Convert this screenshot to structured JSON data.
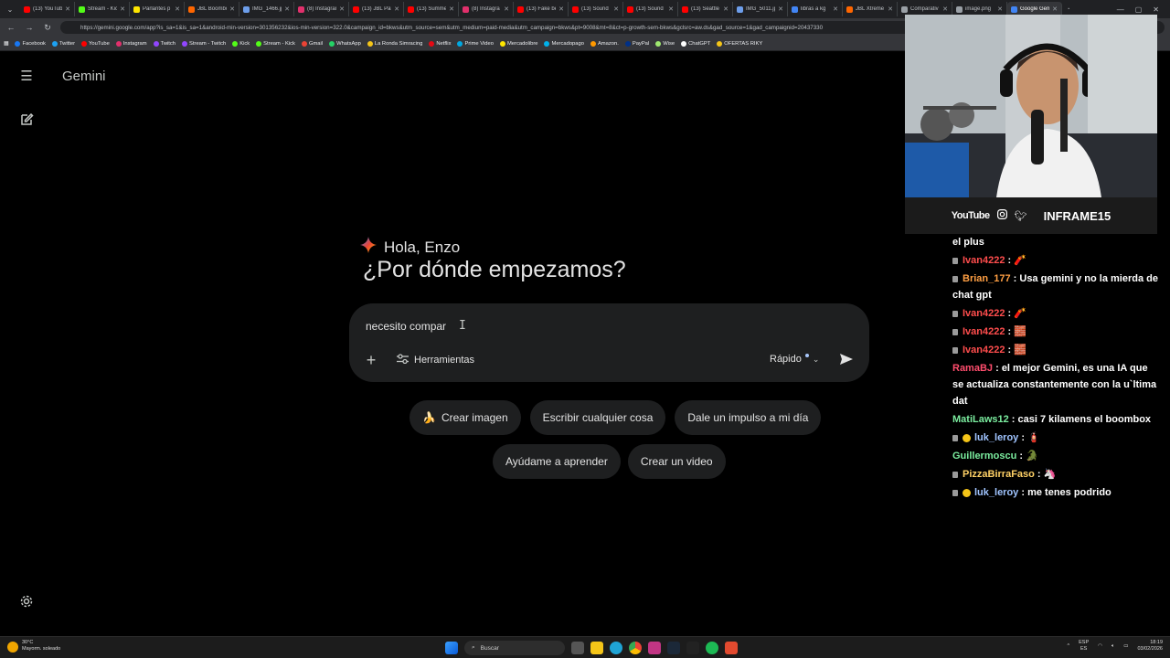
{
  "browser": {
    "tabs": [
      {
        "label": "(13) YouTube",
        "color": "#ff0000"
      },
      {
        "label": "Stream - Kick",
        "color": "#53fc18"
      },
      {
        "label": "Parlantes p",
        "color": "#ffe600"
      },
      {
        "label": "JBL Boombo",
        "color": "#ff6600"
      },
      {
        "label": "IMG_1466.jp",
        "color": "#6d9eeb"
      },
      {
        "label": "(8) Instagram",
        "color": "#e1306c"
      },
      {
        "label": "(13) JBL Par",
        "color": "#ff0000"
      },
      {
        "label": "(13) Summe",
        "color": "#ff0000"
      },
      {
        "label": "(8) Instagra",
        "color": "#e1306c"
      },
      {
        "label": "(13) Fake be",
        "color": "#ff0000"
      },
      {
        "label": "(13) Sound",
        "color": "#ff0000"
      },
      {
        "label": "(13) Sound",
        "color": "#ff0000"
      },
      {
        "label": "(13) Seattle",
        "color": "#ff0000"
      },
      {
        "label": "IMG_5011.jp",
        "color": "#6d9eeb"
      },
      {
        "label": "libras a kg",
        "color": "#4285f4"
      },
      {
        "label": "JBL Xtreme",
        "color": "#ff6600"
      },
      {
        "label": "Comparativ",
        "color": "#9aa0a6"
      },
      {
        "label": "image.png",
        "color": "#9aa0a6"
      },
      {
        "label": "Google Gem",
        "color": "#4285f4",
        "active": true
      }
    ],
    "tab_close": "✕",
    "new_tab": "+",
    "url": "https://gemini.google.com/app?is_sa=1&is_sa=1&android-min-version=301356232&ios-min-version=322.0&campaign_id=bkws&utm_source=sem&utm_medium=paid-media&utm_campaign=bkws&pt=9008&mt=8&ct=p-growth-sem-bkws&gclsrc=aw.ds&gad_source=1&gad_campaignid=20437330",
    "bookmarks": [
      {
        "label": "Facebook",
        "color": "#1877f2"
      },
      {
        "label": "Twitter",
        "color": "#1da1f2"
      },
      {
        "label": "YouTube",
        "color": "#ff0000"
      },
      {
        "label": "Instagram",
        "color": "#e1306c"
      },
      {
        "label": "Twitch",
        "color": "#9146ff"
      },
      {
        "label": "Stream - Twitch",
        "color": "#9146ff"
      },
      {
        "label": "Kick",
        "color": "#53fc18"
      },
      {
        "label": "Stream - Kick",
        "color": "#53fc18"
      },
      {
        "label": "Gmail",
        "color": "#ea4335"
      },
      {
        "label": "WhatsApp",
        "color": "#25d366"
      },
      {
        "label": "La Ronda Simracing",
        "color": "#f5c518"
      },
      {
        "label": "Netflix",
        "color": "#e50914"
      },
      {
        "label": "Prime Video",
        "color": "#00a8e1"
      },
      {
        "label": "Mercadolibre",
        "color": "#ffe600"
      },
      {
        "label": "Mercadopago",
        "color": "#00b1ea"
      },
      {
        "label": "Amazon.",
        "color": "#ff9900"
      },
      {
        "label": "PayPal",
        "color": "#003087"
      },
      {
        "label": "Wise",
        "color": "#9fe870"
      },
      {
        "label": "ChatGPT",
        "color": "#ffffff"
      },
      {
        "label": "OFERTAS RIKY",
        "color": "#f5c518"
      }
    ]
  },
  "gemini": {
    "app_name": "Gemini",
    "greeting": "Hola, Enzo",
    "headline": "¿Por dónde empezamos?",
    "prompt_text": "necesito compar",
    "tools_label": "Herramientas",
    "mode_label": "Rápido",
    "suggestions_row1": [
      {
        "label": "Crear imagen",
        "emoji": "🍌"
      },
      {
        "label": "Escribir cualquier cosa",
        "emoji": ""
      },
      {
        "label": "Dale un impulso a mi día",
        "emoji": ""
      }
    ],
    "suggestions_row2": [
      {
        "label": "Ayúdame a aprender",
        "emoji": ""
      },
      {
        "label": "Crear un video",
        "emoji": ""
      }
    ],
    "accent_colors": [
      "#4285f4",
      "#ea4335",
      "#fbbc04",
      "#34a853"
    ]
  },
  "stream": {
    "youtube_label": "YouTube",
    "channel_handle": "INFRAME15",
    "chat": [
      {
        "user": "",
        "text": "el plus",
        "color": "#ffffff"
      },
      {
        "user": "Ivan4222",
        "text": "🧨",
        "color": "#ff4d4d",
        "badge": "icon"
      },
      {
        "user": "Brian_177",
        "text": "Usa gemini y no la mierda de chat gpt",
        "color": "#ff9f43",
        "badge": "icon"
      },
      {
        "user": "Ivan4222",
        "text": "🧨",
        "color": "#ff4d4d",
        "badge": "icon"
      },
      {
        "user": "Ivan4222",
        "text": "🧱",
        "color": "#ff4d4d",
        "badge": "icon"
      },
      {
        "user": "Ivan4222",
        "text": "🧱",
        "color": "#ff4d4d",
        "badge": "icon"
      },
      {
        "user": "RamaBJ",
        "text": "el mejor Gemini, es una IA que se actualiza constantemente con la u`ltima dat",
        "color": "#ff4d6d",
        "badge": ""
      },
      {
        "user": "MatiLaws12",
        "text": "casi 7 kilamens el boombox",
        "color": "#7bed9f",
        "badge": ""
      },
      {
        "user": "luk_leroy",
        "text": "🧯",
        "color": "#a0c4ff",
        "badge": "warn"
      },
      {
        "user": "Guillermoscu",
        "text": "🐊",
        "color": "#7bed9f",
        "badge": ""
      },
      {
        "user": "PizzaBirraFaso",
        "text": "🦄",
        "color": "#ffd166",
        "badge": "icon"
      },
      {
        "user": "luk_leroy",
        "text": "me tenes podrido",
        "color": "#a0c4ff",
        "badge": "warn"
      }
    ]
  },
  "taskbar": {
    "temperature": "30°C",
    "weather": "Mayorm. soleado",
    "search_placeholder": "Buscar",
    "lang_top": "ESP",
    "lang_bottom": "ES",
    "time": "18:19",
    "date": "03/02/2026"
  }
}
